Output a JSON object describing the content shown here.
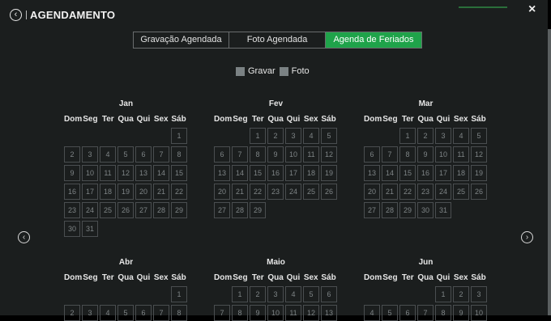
{
  "header": {
    "title": "AGENDAMENTO",
    "back_icon": "‹",
    "close_icon": "×"
  },
  "tabs": [
    {
      "label": "Gravação Agendada",
      "active": false
    },
    {
      "label": "Foto Agendada",
      "active": false
    },
    {
      "label": "Agenda de Feriados",
      "active": true
    }
  ],
  "legend": [
    {
      "label": "Gravar",
      "color": "#7b8284"
    },
    {
      "label": "Foto",
      "color": "#7b8284"
    }
  ],
  "weekdays": [
    "Dom",
    "Seg",
    "Ter",
    "Qua",
    "Qui",
    "Sex",
    "Sáb"
  ],
  "months": [
    {
      "name": "Jan",
      "start": 6,
      "days": 31
    },
    {
      "name": "Fev",
      "start": 2,
      "days": 29
    },
    {
      "name": "Mar",
      "start": 2,
      "days": 31
    },
    {
      "name": "Abr",
      "start": 6,
      "days": 8
    },
    {
      "name": "Maio",
      "start": 1,
      "days": 13
    },
    {
      "name": "Jun",
      "start": 4,
      "days": 10
    }
  ],
  "nav": {
    "prev_icon": "‹",
    "next_icon": "›"
  },
  "colors": {
    "active_tab": "#1fa34a",
    "background": "#1b1e1e",
    "cell_border": "#4a4e50"
  }
}
